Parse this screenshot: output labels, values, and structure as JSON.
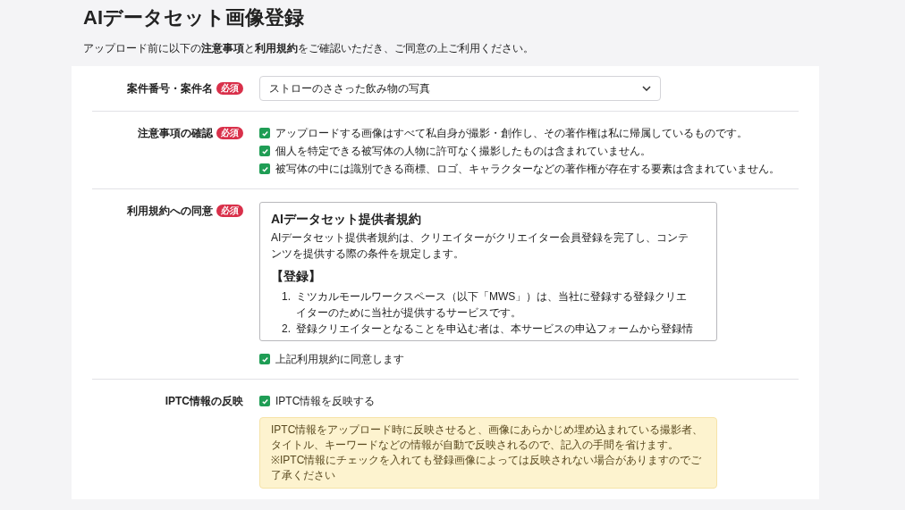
{
  "title": "AIデータセット画像登録",
  "intro": "アップロード前に以下の**注意事項**と**利用規約**をご確認いただき、ご同意の上ご利用ください。",
  "rows": [
    {
      "kind": "select",
      "label": "案件番号・案件名",
      "badge": "必須",
      "value": "ストローのささった飲み物の写真"
    },
    {
      "kind": "checklist",
      "label": "注意事項の確認",
      "badge": "必須",
      "items": [
        {
          "text": "アップロードする画像はすべて私自身が撮影・創作し、その著作権は私に帰属しているものです。",
          "checked": true
        },
        {
          "text": "個人を特定できる被写体の人物に許可なく撮影したものは含まれていません。",
          "checked": true
        },
        {
          "text": "被写体の中には識別できる商標、ロゴ、キャラクターなどの著作権が存在する要素は含まれていません。",
          "checked": true
        }
      ]
    },
    {
      "kind": "terms",
      "label": "利用規約への同意",
      "badge": "必須",
      "terms": {
        "heading": "AIデータセット提供者規約",
        "lead": "AIデータセット提供者規約は、クリエイターがクリエイター会員登録を完了し、コンテンツを提供する際の条件を規定します。",
        "section": "【登録】",
        "list": [
          {
            "number": "1.",
            "text": "ミツカルモールワークスペース（以下「MWS」）は、当社に登録する登録クリエイターのために当社が提供するサービスです。"
          },
          {
            "number": "2.",
            "text": "登録クリエイターとなることを申込む者は、本サービスの申込フォームから登録情"
          }
        ]
      },
      "agree": {
        "text": "上記利用規約に同意します",
        "checked": true
      }
    },
    {
      "kind": "iptc",
      "label": "IPTC情報の反映",
      "option": {
        "text": "IPTC情報を反映する",
        "checked": true
      },
      "notes": [
        "IPTC情報をアップロード時に反映させると、画像にあらかじめ埋め込まれている撮影者、タイトル、キーワードなどの情報が自動で反映されるので、記入の手間を省けます。",
        "※IPTC情報にチェックを入れても登録画像によっては反映されない場合がありますのでご了承ください"
      ]
    }
  ]
}
